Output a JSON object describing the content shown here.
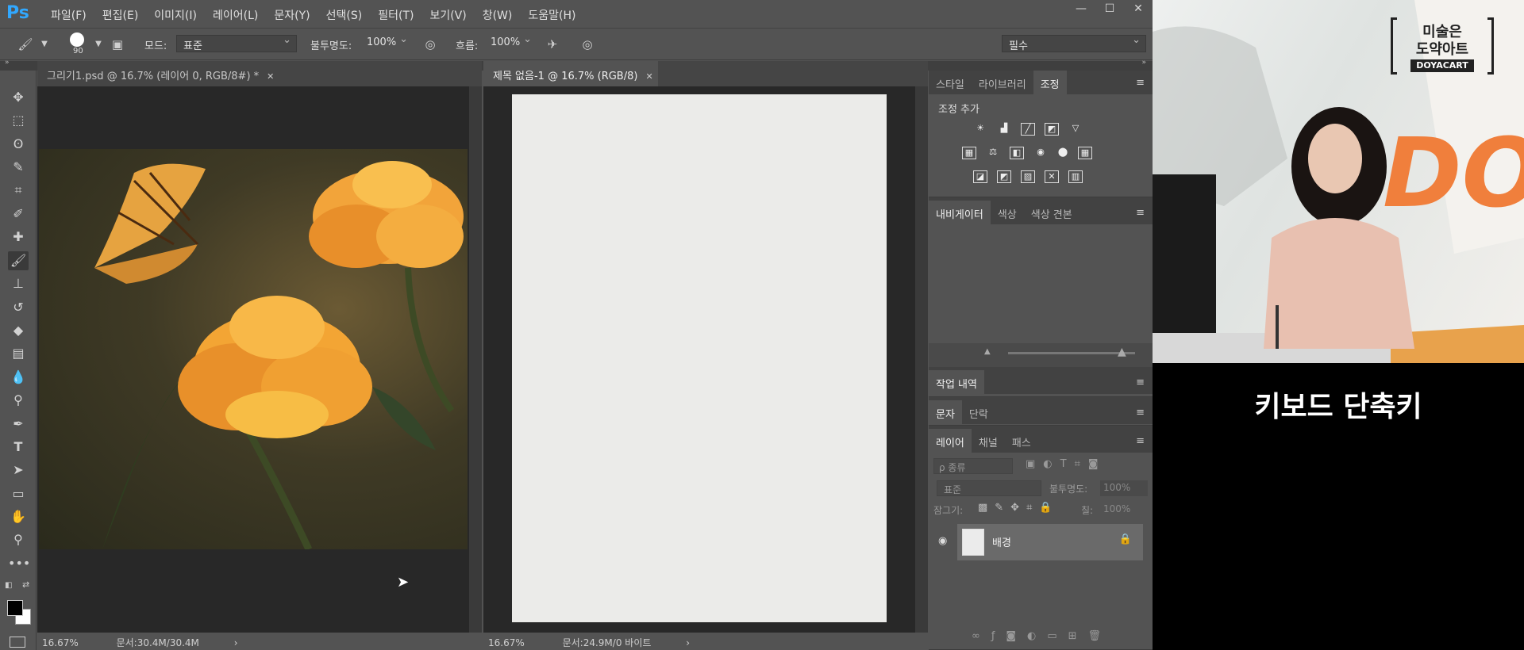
{
  "app": {
    "logo": "Ps"
  },
  "menu": [
    "파일(F)",
    "편집(E)",
    "이미지(I)",
    "레이어(L)",
    "문자(Y)",
    "선택(S)",
    "필터(T)",
    "보기(V)",
    "창(W)",
    "도움말(H)"
  ],
  "window_controls": {
    "min": "—",
    "max": "☐",
    "close": "✕"
  },
  "options": {
    "brush_size": "90",
    "mode_label": "모드:",
    "mode_value": "표준",
    "opacity_label": "불투명도:",
    "opacity_value": "100%",
    "flow_label": "흐름:",
    "flow_value": "100%",
    "workspace": "필수"
  },
  "documents": [
    {
      "tab": "그리기1.psd @ 16.7% (레이어 0, RGB/8#) *",
      "zoom": "16.67%",
      "doc_info": "문서:30.4M/30.4M"
    },
    {
      "tab": "제목 없음-1 @ 16.7% (RGB/8)",
      "zoom": "16.67%",
      "doc_info": "문서:24.9M/0 바이트"
    }
  ],
  "panels": {
    "top_tabs": [
      "스타일",
      "라이브러리",
      "조정"
    ],
    "adjust_title": "조정 추가",
    "nav_tabs": [
      "내비게이터",
      "색상",
      "색상 견본"
    ],
    "history_tab": "작업 내역",
    "char_tabs": [
      "문자",
      "단락"
    ],
    "layer_tabs": [
      "레이어",
      "채널",
      "패스"
    ],
    "layer_filter": "ρ 종류",
    "blend_mode": "표준",
    "layer_opacity_label": "불투명도:",
    "layer_opacity_value": "100%",
    "lock_label": "잠그기:",
    "fill_label": "칠:",
    "fill_value": "100%",
    "layer_name": "배경"
  },
  "webcam": {
    "brand_line1": "미술은",
    "brand_line2": "도약아트",
    "brand_en": "DOYACART",
    "wall_text": "DO",
    "caption": "키보드 단축키"
  },
  "colors": {
    "ps_accent": "#31a8ff",
    "ui_bg": "#535353",
    "canvas_bg": "#282828",
    "brand_orange": "#f07f3c"
  }
}
